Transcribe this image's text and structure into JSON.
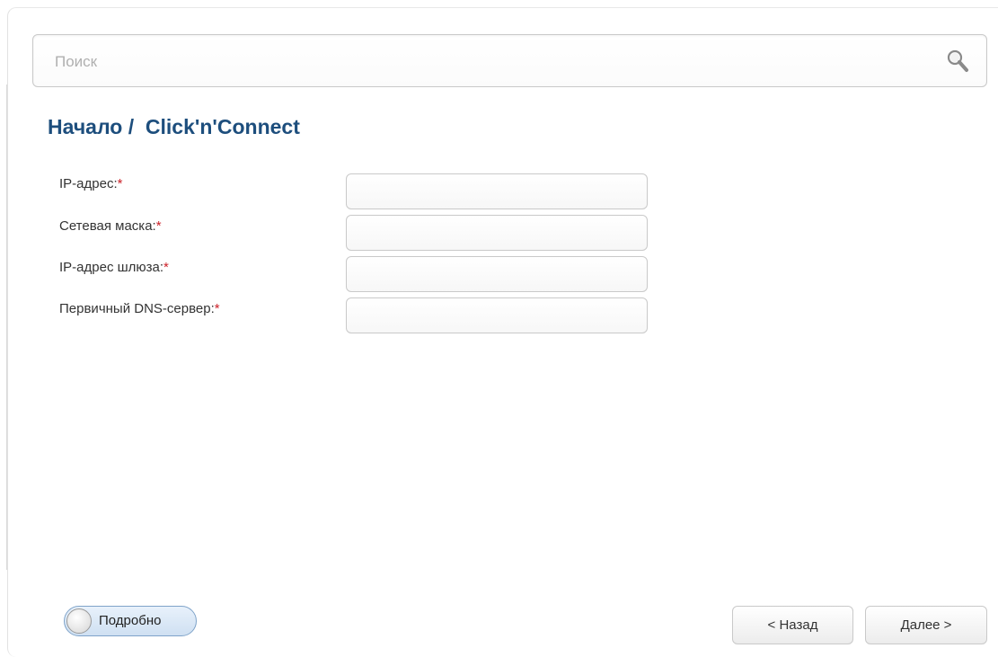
{
  "search": {
    "placeholder": "Поиск",
    "value": ""
  },
  "breadcrumb": {
    "home": "Начало",
    "separator": "/",
    "current": "Click'n'Connect"
  },
  "form": {
    "fields": [
      {
        "label": "IP-адрес:",
        "required_mark": "*",
        "value": ""
      },
      {
        "label": "Сетевая маска:",
        "required_mark": "*",
        "value": ""
      },
      {
        "label": "IP-адрес шлюза:",
        "required_mark": "*",
        "value": ""
      },
      {
        "label": "Первичный DNS-сервер:",
        "required_mark": "*",
        "value": ""
      }
    ]
  },
  "footer": {
    "details_toggle_label": "Подробно",
    "back_label": "< Назад",
    "next_label": "Далее >"
  },
  "colors": {
    "title": "#1d4e7d",
    "required": "#cc2229",
    "toggle_border": "#7fa3c9"
  },
  "icons": {
    "search": "search-icon"
  }
}
